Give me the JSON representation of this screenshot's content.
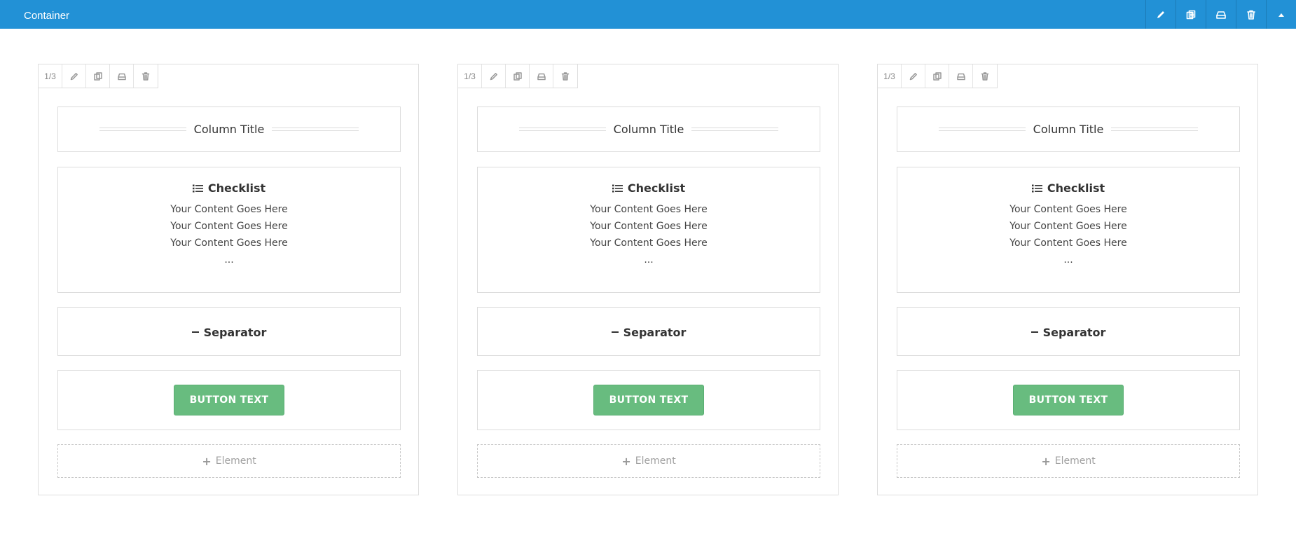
{
  "topbar": {
    "title": "Container",
    "color": "#2291d6",
    "actions": [
      "pencil-icon",
      "copy-icon",
      "save-icon",
      "trash-icon",
      "caret-up-icon"
    ]
  },
  "columns": [
    {
      "size": "1/3",
      "title": "Column Title",
      "checklist": {
        "heading": "Checklist",
        "items": [
          "Your Content Goes Here",
          "Your Content Goes Here",
          "Your Content Goes Here",
          "..."
        ]
      },
      "separator": "Separator",
      "button": "BUTTON TEXT",
      "add_element": "Element"
    },
    {
      "size": "1/3",
      "title": "Column Title",
      "checklist": {
        "heading": "Checklist",
        "items": [
          "Your Content Goes Here",
          "Your Content Goes Here",
          "Your Content Goes Here",
          "..."
        ]
      },
      "separator": "Separator",
      "button": "BUTTON TEXT",
      "add_element": "Element"
    },
    {
      "size": "1/3",
      "title": "Column Title",
      "checklist": {
        "heading": "Checklist",
        "items": [
          "Your Content Goes Here",
          "Your Content Goes Here",
          "Your Content Goes Here",
          "..."
        ]
      },
      "separator": "Separator",
      "button": "BUTTON TEXT",
      "add_element": "Element"
    }
  ],
  "colors": {
    "button_green": "#68bc7f",
    "border": "#dedede"
  }
}
